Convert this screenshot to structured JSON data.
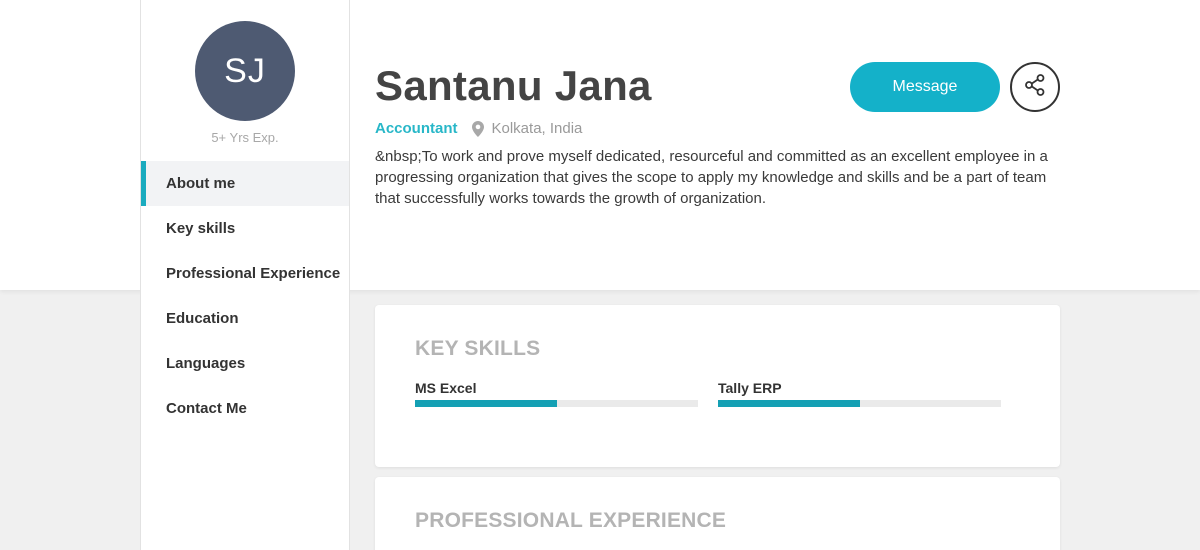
{
  "profile": {
    "initials": "SJ",
    "experience": "5+ Yrs Exp.",
    "name": "Santanu Jana",
    "role": "Accountant",
    "location": "Kolkata, India",
    "about": "&nbsp;To work and prove myself dedicated, resourceful and committed as an excellent employee in a progressing organization that gives the scope to apply my knowledge and skills and be a part of team that successfully works towards the growth of organization."
  },
  "actions": {
    "message_label": "Message",
    "share_icon": "share-icon"
  },
  "nav": {
    "items": [
      {
        "label": "About me",
        "active": true
      },
      {
        "label": "Key skills",
        "active": false
      },
      {
        "label": "Professional Experience",
        "active": false
      },
      {
        "label": "Education",
        "active": false
      },
      {
        "label": "Languages",
        "active": false
      },
      {
        "label": "Contact Me",
        "active": false
      }
    ]
  },
  "skills_section": {
    "title": "KEY SKILLS",
    "skills": [
      {
        "name": "MS Excel",
        "level": 0.5
      },
      {
        "name": "Tally ERP",
        "level": 0.5
      }
    ]
  },
  "experience_section": {
    "title": "PROFESSIONAL EXPERIENCE"
  },
  "colors": {
    "accent": "#14b1c9",
    "avatar_bg": "#4e5a72",
    "skill_bar": "#14a0b4"
  }
}
